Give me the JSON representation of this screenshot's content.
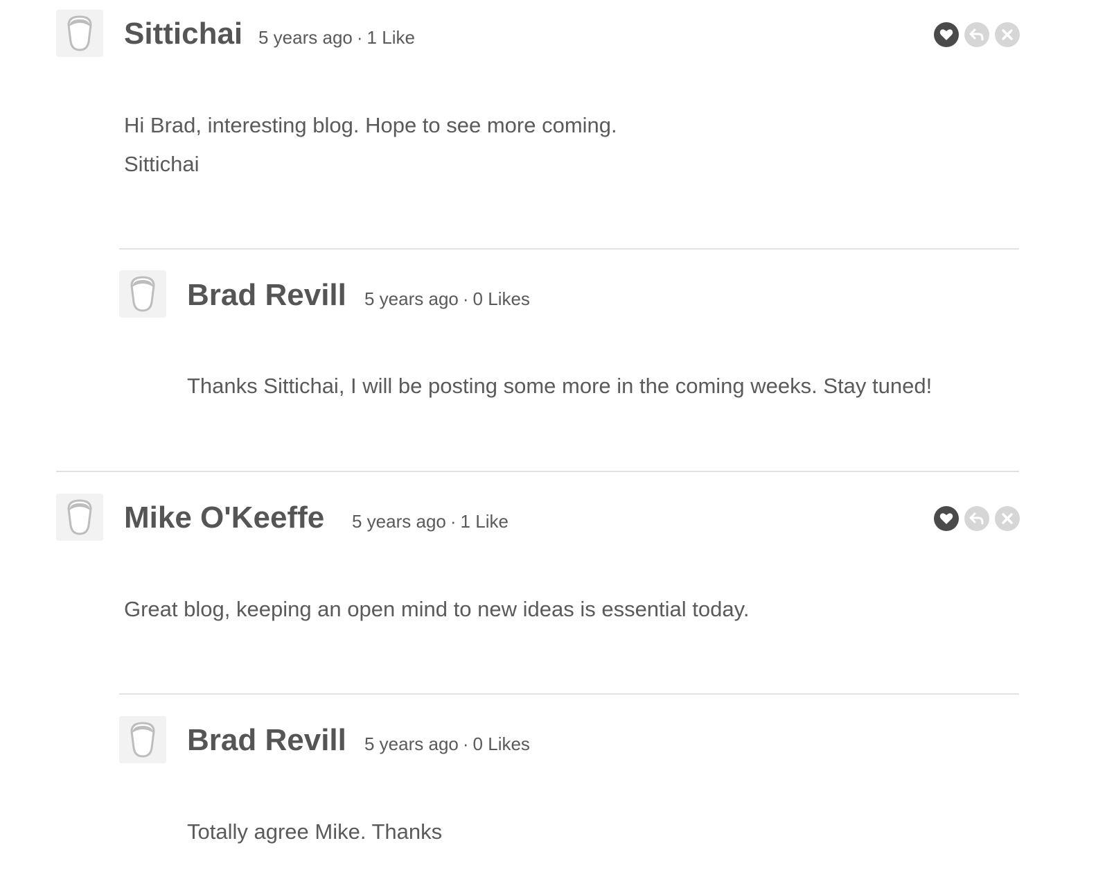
{
  "comments": [
    {
      "author": "Sittichai",
      "time": "5 years ago",
      "likes": "1 Like",
      "body": [
        "Hi Brad, interesting blog. Hope to see more coming.",
        "Sittichai"
      ],
      "reply": {
        "author": "Brad Revill",
        "time": "5 years ago",
        "likes": "0 Likes",
        "body": "Thanks Sittichai, I will be posting some more in the coming weeks. Stay tuned!"
      }
    },
    {
      "author": "Mike O'Keeffe",
      "time": "5 years ago",
      "likes": "1 Like",
      "body": [
        "Great blog, keeping an open mind to new ideas is essential today."
      ],
      "reply": {
        "author": "Brad Revill",
        "time": "5 years ago",
        "likes": "0 Likes",
        "body": "Totally agree Mike. Thanks"
      }
    }
  ],
  "separator": "·",
  "icons": {
    "avatar": "default-avatar-icon",
    "like": "heart-icon",
    "reply": "reply-arrow-icon",
    "close": "close-x-icon"
  },
  "colors": {
    "like_button": "#4a4a4a",
    "muted_button": "#d6d6d6",
    "text": "#555555",
    "rule": "#e2e2e2"
  }
}
